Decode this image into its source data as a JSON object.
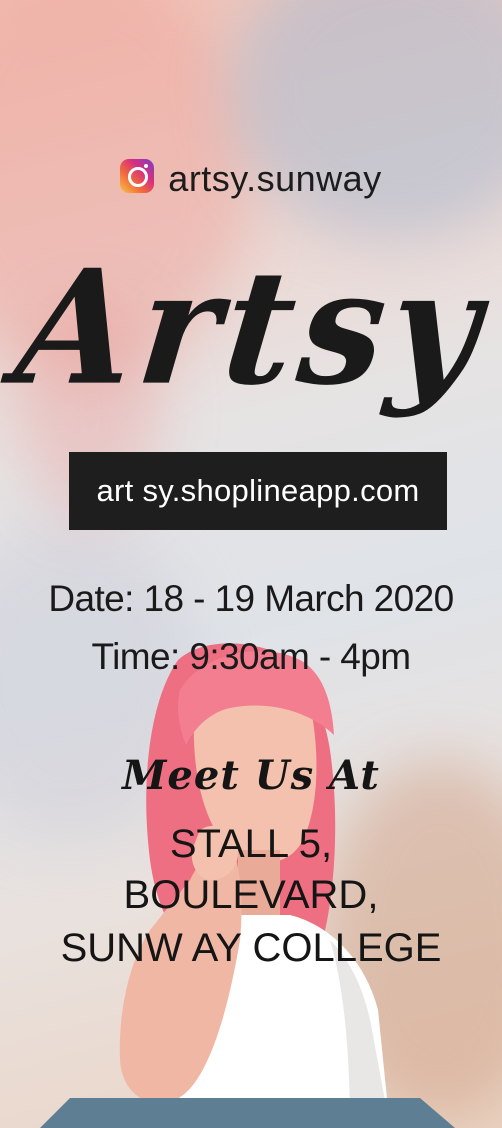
{
  "instagram": {
    "icon": "instagram-icon",
    "handle": "artsy.sunway",
    "icon_colors": [
      "#f9c34a",
      "#f26a3b",
      "#d62f7f",
      "#7a3ec8"
    ]
  },
  "brand": {
    "name": "Artsy"
  },
  "website": {
    "url": "art sy.shoplineapp.com"
  },
  "event": {
    "date": "Date: 18 - 19 March 2020",
    "time": "Time: 9:30am - 4pm"
  },
  "location": {
    "heading": "Meet Us At",
    "line1": "STALL 5,",
    "line2": "BOULEVARD,",
    "line3": "SUNW AY COLLEGE"
  },
  "colors": {
    "text": "#1a1a1a",
    "url_box": "#1e1e1e",
    "hair": "#ee6f82",
    "skin": "#f3c1ad",
    "shirt": "#ffffff",
    "table": "#5e7f93"
  }
}
